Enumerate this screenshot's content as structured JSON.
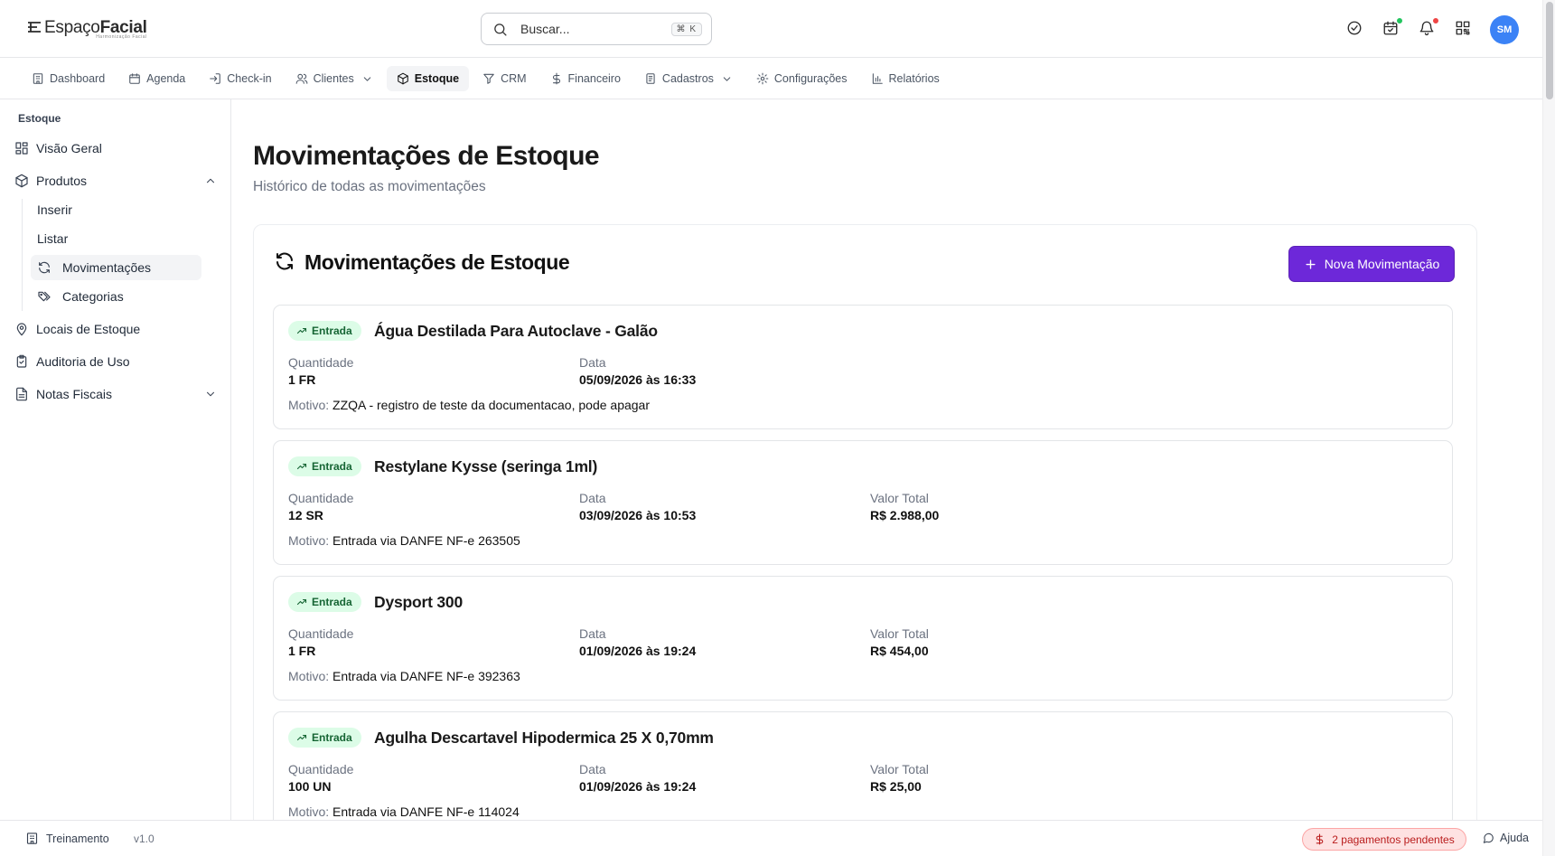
{
  "brand": {
    "name_light": "Espaço",
    "name_bold": "Facial",
    "tagline": "Harmonização Facial"
  },
  "search": {
    "placeholder": "Buscar...",
    "shortcut": "⌘ K"
  },
  "header": {
    "avatar_initials": "SM",
    "colors": {
      "online_dot": "#22c55e",
      "notify_dot": "#ef4444",
      "avatar": "#3b82f6"
    }
  },
  "nav": {
    "items": [
      {
        "label": "Dashboard",
        "icon": "building-icon"
      },
      {
        "label": "Agenda",
        "icon": "calendar-icon"
      },
      {
        "label": "Check-in",
        "icon": "login-icon"
      },
      {
        "label": "Clientes",
        "icon": "users-icon"
      },
      {
        "label": "Estoque",
        "icon": "package-icon"
      },
      {
        "label": "CRM",
        "icon": "funnel-icon"
      },
      {
        "label": "Financeiro",
        "icon": "dollar-icon"
      },
      {
        "label": "Cadastros",
        "icon": "clipboard-icon"
      },
      {
        "label": "Configurações",
        "icon": "gear-icon"
      },
      {
        "label": "Relatórios",
        "icon": "bar-chart-icon"
      }
    ],
    "active": "Estoque"
  },
  "sidebar": {
    "section": "Estoque",
    "visao_geral": "Visão Geral",
    "produtos": "Produtos",
    "inserir": "Inserir",
    "listar": "Listar",
    "movimentacoes": "Movimentações",
    "categorias": "Categorias",
    "locais": "Locais de Estoque",
    "auditoria": "Auditoria de Uso",
    "notas": "Notas Fiscais"
  },
  "page": {
    "title": "Movimentações de Estoque",
    "subtitle": "Histórico de todas as movimentações"
  },
  "panel": {
    "title": "Movimentações de Estoque",
    "new_button": "Nova Movimentação",
    "accent_color": "#6d28d9"
  },
  "labels": {
    "quantidade": "Quantidade",
    "data": "Data",
    "valor_total": "Valor Total",
    "motivo": "Motivo:"
  },
  "movements": [
    {
      "type": "Entrada",
      "product": "Água Destilada Para Autoclave - Galão",
      "quantity": "1 FR",
      "date": "05/09/2026 às 16:33",
      "total": null,
      "reason": "ZZQA - registro de teste da documentacao, pode apagar"
    },
    {
      "type": "Entrada",
      "product": "Restylane Kysse (seringa 1ml)",
      "quantity": "12 SR",
      "date": "03/09/2026 às 10:53",
      "total": "R$ 2.988,00",
      "reason": "Entrada via DANFE NF-e 263505"
    },
    {
      "type": "Entrada",
      "product": "Dysport 300",
      "quantity": "1 FR",
      "date": "01/09/2026 às 19:24",
      "total": "R$ 454,00",
      "reason": "Entrada via DANFE NF-e 392363"
    },
    {
      "type": "Entrada",
      "product": "Agulha Descartavel Hipodermica 25 X 0,70mm",
      "quantity": "100 UN",
      "date": "01/09/2026 às 19:24",
      "total": "R$ 25,00",
      "reason": "Entrada via DANFE NF-e 114024"
    }
  ],
  "footer": {
    "training": "Treinamento",
    "version": "v1.0",
    "pending_payments": "2 pagamentos pendentes",
    "help": "Ajuda"
  }
}
